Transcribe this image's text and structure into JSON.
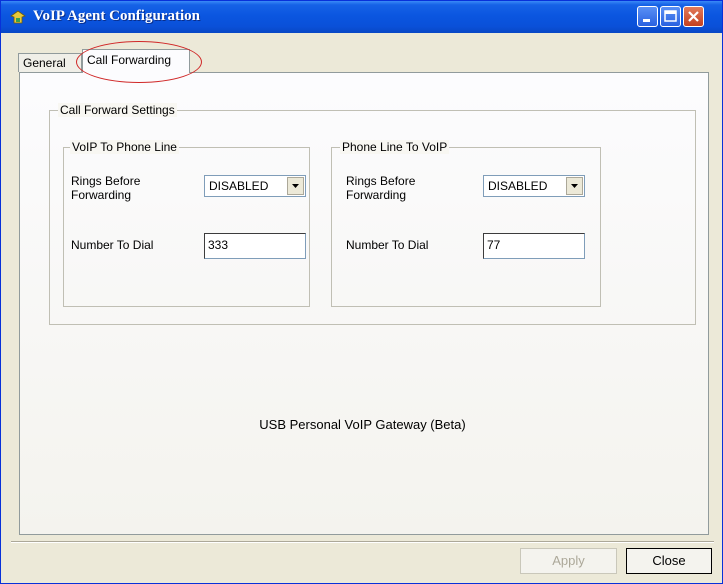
{
  "window": {
    "title": "VoIP Agent Configuration",
    "icon": "app-icon",
    "controls": [
      "minimize-icon",
      "maximize-icon",
      "close-icon"
    ]
  },
  "tabs": [
    {
      "label": "General",
      "selected": false
    },
    {
      "label": "Call Forwarding",
      "selected": true
    }
  ],
  "call_forward": {
    "group_title": "Call Forward Settings",
    "voip_to_phone": {
      "title": "VoIP To Phone Line",
      "rings_label": "Rings Before Forwarding",
      "rings_value": "DISABLED",
      "number_label": "Number To Dial",
      "number_value": "333"
    },
    "phone_to_voip": {
      "title": "Phone Line To VoIP",
      "rings_label": "Rings Before Forwarding",
      "rings_value": "DISABLED",
      "number_label": "Number To Dial",
      "number_value": "77"
    }
  },
  "product": "USB Personal VoIP Gateway (Beta)",
  "buttons": {
    "apply": "Apply",
    "close": "Close"
  },
  "colors": {
    "titlebar": "#0a50d8",
    "highlight": "#d02828",
    "window_bg": "#ece9d8"
  }
}
